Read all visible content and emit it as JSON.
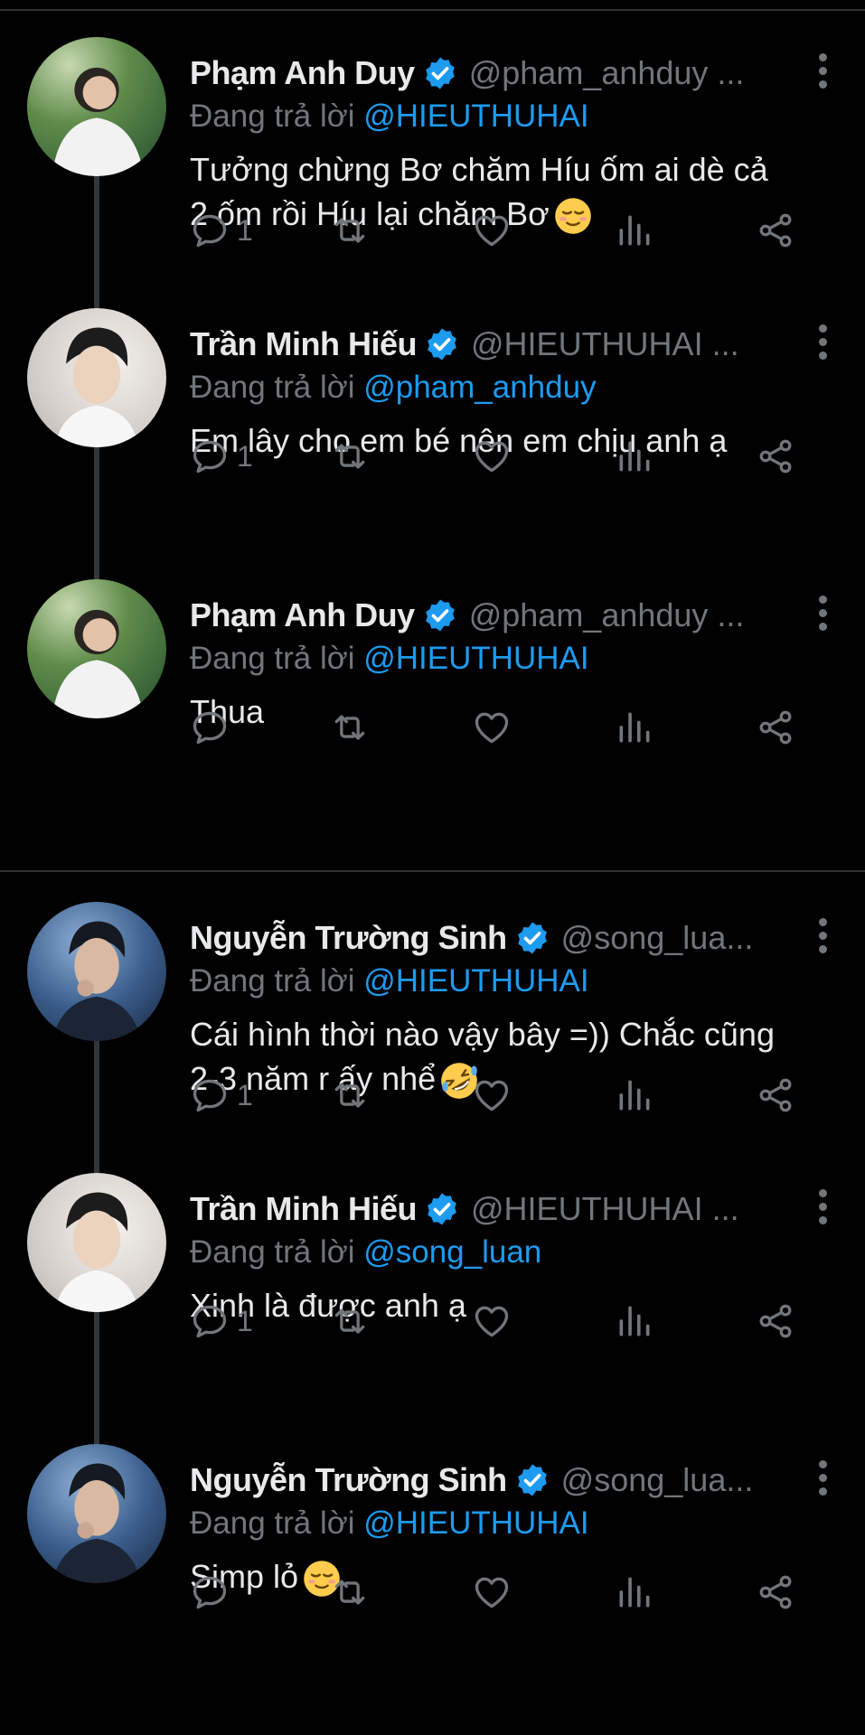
{
  "reply_prefix": "Đang trả lời ",
  "colors": {
    "background": "#000000",
    "text": "#e7e9ea",
    "muted": "#71767b",
    "accent": "#1d9bf0",
    "verified": "#1d9bf0"
  },
  "tweets": [
    {
      "name": "Phạm Anh Duy",
      "handle": "@pham_anhduy ...",
      "reply_to": "@HIEUTHUHAI",
      "text_lines": [
        "Tưởng chừng Bơ chăm Híu ốm ai dè cả",
        "2 ốm rồi Híu lại chăm Bơ"
      ],
      "emoji": "relieved-face",
      "reply_count": "1"
    },
    {
      "name": "Trần Minh Hiếu",
      "handle": "@HIEUTHUHAI ...",
      "reply_to": "@pham_anhduy",
      "text_lines": [
        "Em lây cho em bé nên em chịu anh ạ"
      ],
      "emoji": "",
      "reply_count": "1"
    },
    {
      "name": "Phạm Anh Duy",
      "handle": "@pham_anhduy ...",
      "reply_to": "@HIEUTHUHAI",
      "text_lines": [
        "Thua"
      ],
      "emoji": "",
      "reply_count": ""
    },
    {
      "name": "Nguyễn Trường Sinh",
      "handle": "@song_lua...",
      "reply_to": "@HIEUTHUHAI",
      "text_lines": [
        "Cái hình thời nào vậy bây =)) Chắc cũng",
        "2-3 năm r ấy nhể"
      ],
      "emoji": "rofl-face",
      "reply_count": "1"
    },
    {
      "name": "Trần Minh Hiếu",
      "handle": "@HIEUTHUHAI ...",
      "reply_to": "@song_luan",
      "text_lines": [
        "Xinh là được anh ạ"
      ],
      "emoji": "",
      "reply_count": "1"
    },
    {
      "name": "Nguyễn Trường Sinh",
      "handle": "@song_lua...",
      "reply_to": "@HIEUTHUHAI",
      "text_lines": [
        "Simp lỏ"
      ],
      "emoji": "relieved-face",
      "reply_count": ""
    }
  ]
}
